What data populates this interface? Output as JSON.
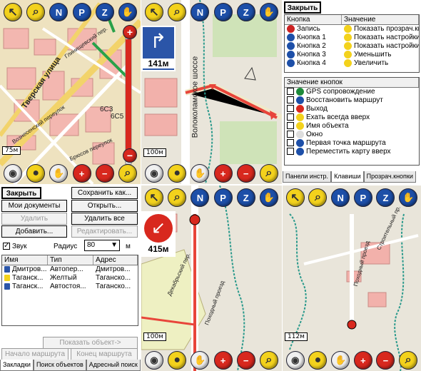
{
  "maps": {
    "tl": {
      "street1": "Тверская улица",
      "street2": "Глинищевский пер.",
      "street3": "Брюсов переулок",
      "house1": "6С3",
      "house2": "6С5",
      "scale": "75м",
      "street4": "Вознесенский переулок"
    },
    "tc": {
      "turn_distance": "141м",
      "street": "Волоколамское шоссе",
      "scale": "100м"
    },
    "bc": {
      "turn_distance": "415м",
      "street1": "Декабрьский пер.",
      "street2": "Походный проезд",
      "scale": "100м"
    },
    "br": {
      "street1": "Строительный пр.",
      "street2": "Походный проезд",
      "scale": "112м"
    }
  },
  "bookmarks": {
    "close": "Закрыть",
    "save_as": "Сохранить как...",
    "my_docs": "Мои документы",
    "open": "Открыть...",
    "delete": "Удалить",
    "delete_all": "Удалить все",
    "add": "Добавить...",
    "edit": "Редактировать...",
    "sound": "Звук",
    "radius_label": "Радиус",
    "radius_value": "80",
    "radius_unit": "м",
    "columns": [
      "Имя",
      "Тип",
      "Адрес"
    ],
    "rows": [
      [
        "Дмитров...",
        "Автопер...",
        "Дмитров..."
      ],
      [
        "Таганск...",
        "Желтый",
        "Таганско..."
      ],
      [
        "Таганск...",
        "Автостоя...",
        "Таганско..."
      ]
    ],
    "show_object": "Показать объект->",
    "route_start": "Начало маршрута",
    "route_end": "Конец маршрута",
    "tabs": [
      "Закладки",
      "Поиск объектов",
      "Адресный поиск"
    ]
  },
  "keys": {
    "close": "Закрыть",
    "col_button": "Кнопка",
    "col_value": "Значение",
    "rows": [
      [
        "Запись",
        "Показать прозрач.кнопки"
      ],
      [
        "Кнопка 1",
        "Показать настройки"
      ],
      [
        "Кнопка 2",
        "Показать настройки"
      ],
      [
        "Кнопка 3",
        "Уменьшить"
      ],
      [
        "Кнопка 4",
        "Увеличить"
      ]
    ],
    "list_header": "Значение кнопок",
    "list": [
      "GPS сопровождение",
      "Восстановить маршрут",
      "Выход",
      "Ехать всегда вверх",
      "Имя объекта",
      "Окно",
      "Первая точка маршрута",
      "Переместить карту вверх"
    ],
    "tabs": [
      "Панели инстр.",
      "Клавиши",
      "Прозрач.кнопки"
    ]
  },
  "toolbar": {
    "top": [
      "cursor-icon",
      "zoom-icon",
      "north-icon",
      "parking-icon",
      "route-icon",
      "hand-icon"
    ],
    "bottom": [
      "gps-icon",
      "record-icon",
      "hand-icon",
      "zoom-in-icon",
      "zoom-out-icon",
      "search-icon"
    ]
  }
}
